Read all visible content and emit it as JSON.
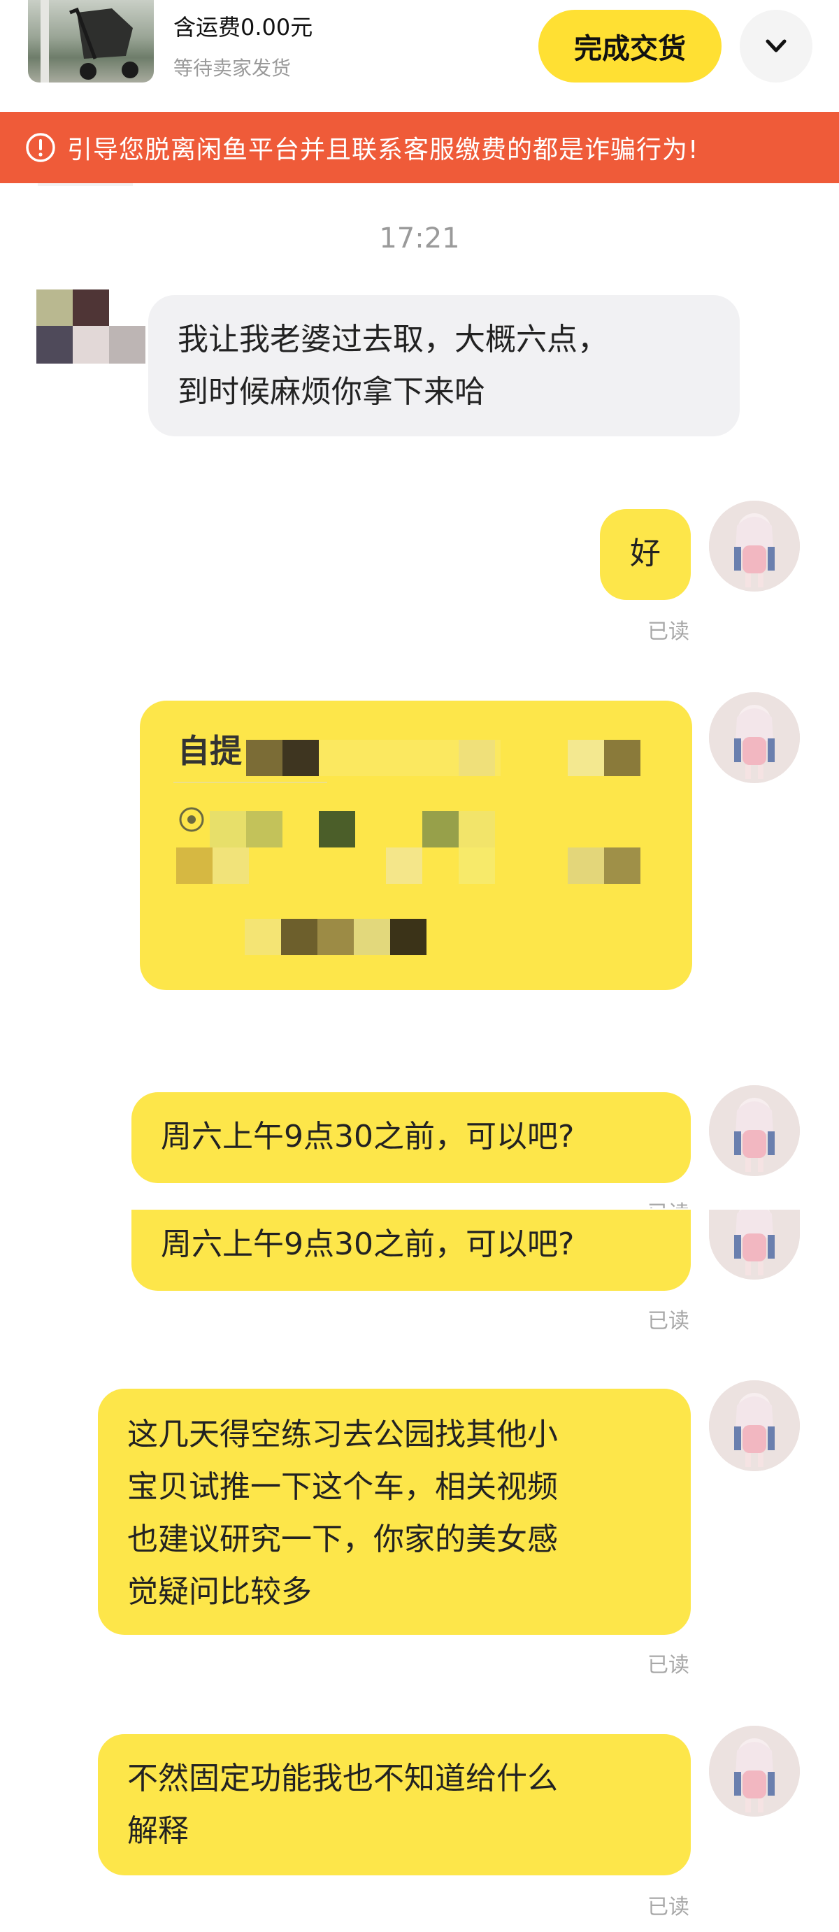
{
  "order": {
    "price_text": "含运费0.00元",
    "status_text": "等待卖家发货",
    "complete_button_label": "完成交货"
  },
  "warning": {
    "text": "引导您脱离闲鱼平台并且联系客服缴费的都是诈骗行为!"
  },
  "chat": {
    "time": "17:21",
    "read_label": "已读",
    "messages": [
      {
        "from": "seller",
        "lines": [
          "我让我老婆过去取，大概六点，",
          "到时候麻烦你拿下来哈"
        ]
      },
      {
        "from": "me",
        "lines": [
          "好"
        ],
        "read": true
      },
      {
        "from": "me",
        "type": "pickup-card",
        "title_partial": "自提",
        "redacted": true
      },
      {
        "from": "me",
        "lines": [
          "周六上午9点30之前，可以吧?"
        ],
        "read": true
      },
      {
        "from": "me",
        "lines": [
          "周六上午9点30之前，可以吧?"
        ],
        "read": true
      },
      {
        "from": "me",
        "lines": [
          "这几天得空练习去公园找其他小",
          "宝贝试推一下这个车，相关视频",
          "也建议研究一下，你家的美女感",
          "觉疑问比较多"
        ],
        "read": true
      },
      {
        "from": "me",
        "lines": [
          "不然固定功能我也不知道给什么",
          "解释"
        ],
        "read": true
      }
    ]
  },
  "colors": {
    "accent_yellow": "#fde64a",
    "warning_orange": "#ef5b39",
    "incoming_bubble": "#f1f1f3"
  },
  "icons": [
    "warning-circle-icon",
    "chevron-down-icon",
    "location-pin-icon"
  ]
}
